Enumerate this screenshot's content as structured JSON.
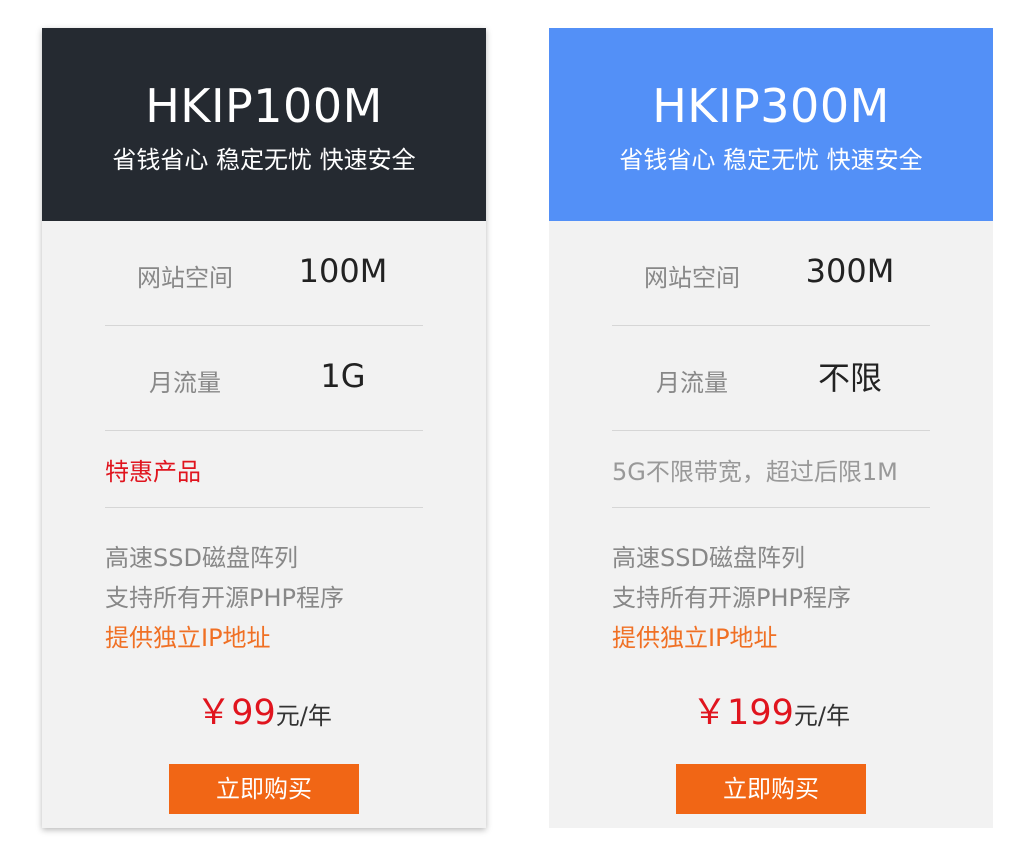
{
  "plans": [
    {
      "title": "HKIP100M",
      "slogan": "省钱省心 稳定无忧 快速安全",
      "specs": [
        {
          "label": "网站空间",
          "value": "100M"
        },
        {
          "label": "月流量",
          "value": "1G"
        }
      ],
      "note": "特惠产品",
      "features": [
        "高速SSD磁盘阵列",
        "支持所有开源PHP程序",
        "提供独立IP地址"
      ],
      "price": {
        "currency": "￥",
        "amount": "99",
        "unit": "元/年"
      },
      "buy_label": "立即购买"
    },
    {
      "title": "HKIP300M",
      "slogan": "省钱省心 稳定无忧 快速安全",
      "specs": [
        {
          "label": "网站空间",
          "value": "300M"
        },
        {
          "label": "月流量",
          "value": "不限"
        }
      ],
      "note": "5G不限带宽，超过后限1M",
      "features": [
        "高速SSD磁盘阵列",
        "支持所有开源PHP程序",
        "提供独立IP地址"
      ],
      "price": {
        "currency": "￥",
        "amount": "199",
        "unit": "元/年"
      },
      "buy_label": "立即购买"
    }
  ],
  "colors": {
    "header_dark": "#252a31",
    "header_blue": "#5390f7",
    "card_bg": "#f2f2f2",
    "price_red": "#e0141e",
    "feature_orange": "#f07024",
    "button_orange": "#f16615"
  }
}
